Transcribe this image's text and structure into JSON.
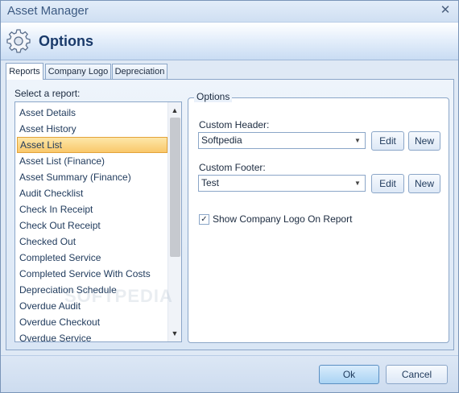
{
  "window": {
    "title": "Asset Manager",
    "close_glyph": "✕"
  },
  "header": {
    "title": "Options",
    "icon": "gear-icon"
  },
  "tabs": [
    {
      "label": "Reports",
      "active": true
    },
    {
      "label": "Company Logo",
      "active": false
    },
    {
      "label": "Depreciation",
      "active": false
    }
  ],
  "reports": {
    "select_label": "Select a report:",
    "items": [
      "Asset Details",
      "Asset History",
      "Asset List",
      "Asset List (Finance)",
      "Asset Summary (Finance)",
      "Audit Checklist",
      "Check In Receipt",
      "Check Out Receipt",
      "Checked Out",
      "Completed Service",
      "Completed Service With Costs",
      "Depreciation Schedule",
      "Overdue Audit",
      "Overdue Checkout",
      "Overdue Service"
    ],
    "selected": "Asset List"
  },
  "options": {
    "legend": "Options",
    "custom_header": {
      "label": "Custom Header:",
      "value": "Softpedia",
      "edit": "Edit",
      "new": "New"
    },
    "custom_footer": {
      "label": "Custom Footer:",
      "value": "Test",
      "edit": "Edit",
      "new": "New"
    },
    "show_logo": {
      "label": "Show Company Logo On Report",
      "checked": true,
      "check_glyph": "✓"
    }
  },
  "footer": {
    "ok": "Ok",
    "cancel": "Cancel"
  },
  "scroll": {
    "up": "▲",
    "down": "▼"
  },
  "combo_arrow": "▼",
  "watermark": "SOFTPEDIA"
}
